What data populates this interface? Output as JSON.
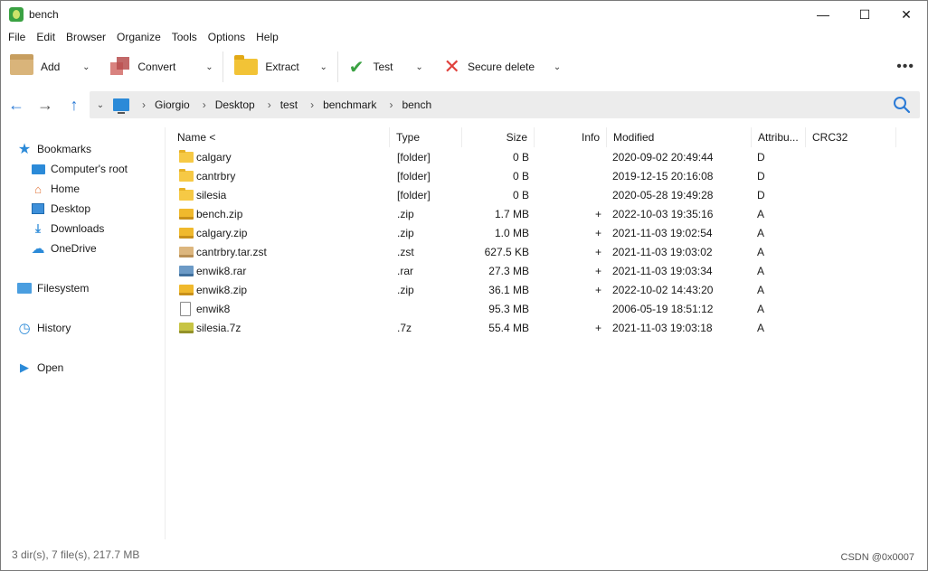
{
  "window": {
    "title": "bench",
    "controls": [
      "—",
      "☐",
      "✕"
    ]
  },
  "menu": [
    "File",
    "Edit",
    "Browser",
    "Organize",
    "Tools",
    "Options",
    "Help"
  ],
  "toolbar": {
    "add": "Add",
    "convert": "Convert",
    "extract": "Extract",
    "test": "Test",
    "secure_delete": "Secure delete",
    "more": "•••"
  },
  "path": [
    "Giorgio",
    "Desktop",
    "test",
    "benchmark",
    "bench"
  ],
  "sidebar": {
    "bookmarks": "Bookmarks",
    "items": [
      "Computer's root",
      "Home",
      "Desktop",
      "Downloads",
      "OneDrive"
    ],
    "filesystem": "Filesystem",
    "history": "History",
    "open": "Open"
  },
  "columns": {
    "name": "Name <",
    "type": "Type",
    "size": "Size",
    "info": "Info",
    "modified": "Modified",
    "attributes": "Attribu...",
    "crc32": "CRC32"
  },
  "files": [
    {
      "name": "calgary",
      "type": "[folder]",
      "size": "0 B",
      "info": "",
      "modified": "2020-09-02 20:49:44",
      "attr": "D",
      "icon": "folder"
    },
    {
      "name": "cantrbry",
      "type": "[folder]",
      "size": "0 B",
      "info": "",
      "modified": "2019-12-15 20:16:08",
      "attr": "D",
      "icon": "folder"
    },
    {
      "name": "silesia",
      "type": "[folder]",
      "size": "0 B",
      "info": "",
      "modified": "2020-05-28 19:49:28",
      "attr": "D",
      "icon": "folder"
    },
    {
      "name": "bench.zip",
      "type": ".zip",
      "size": "1.7 MB",
      "info": "+",
      "modified": "2022-10-03 19:35:16",
      "attr": "A",
      "icon": "zip"
    },
    {
      "name": "calgary.zip",
      "type": ".zip",
      "size": "1.0 MB",
      "info": "+",
      "modified": "2021-11-03 19:02:54",
      "attr": "A",
      "icon": "zip"
    },
    {
      "name": "cantrbry.tar.zst",
      "type": ".zst",
      "size": "627.5 KB",
      "info": "+",
      "modified": "2021-11-03 19:03:02",
      "attr": "A",
      "icon": "zst"
    },
    {
      "name": "enwik8.rar",
      "type": ".rar",
      "size": "27.3 MB",
      "info": "+",
      "modified": "2021-11-03 19:03:34",
      "attr": "A",
      "icon": "rar"
    },
    {
      "name": "enwik8.zip",
      "type": ".zip",
      "size": "36.1 MB",
      "info": "+",
      "modified": "2022-10-02 14:43:20",
      "attr": "A",
      "icon": "zip"
    },
    {
      "name": "enwik8",
      "type": "",
      "size": "95.3 MB",
      "info": "",
      "modified": "2006-05-19 18:51:12",
      "attr": "A",
      "icon": "doc"
    },
    {
      "name": "silesia.7z",
      "type": ".7z",
      "size": "55.4 MB",
      "info": "+",
      "modified": "2021-11-03 19:03:18",
      "attr": "A",
      "icon": "sz"
    }
  ],
  "status": "3 dir(s), 7 file(s), 217.7 MB",
  "watermark": "CSDN @0x0007"
}
